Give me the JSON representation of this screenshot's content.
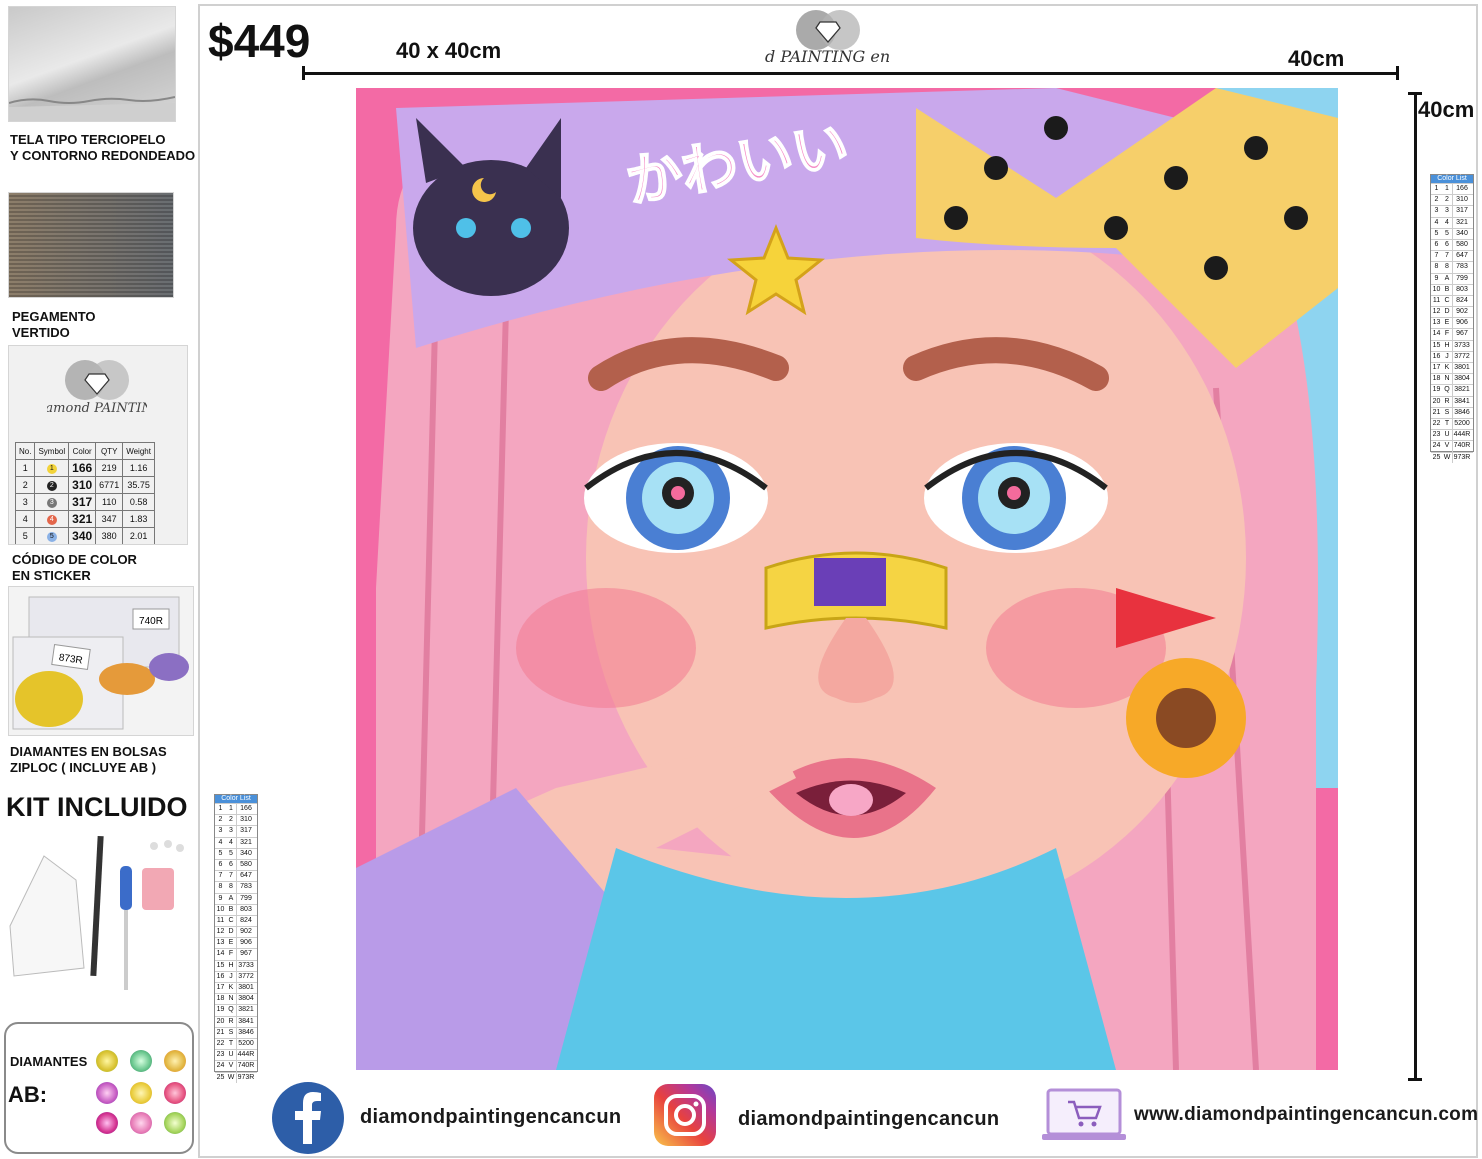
{
  "sidebar": {
    "velvet_caption": [
      "TELA TIPO TERCIOPELO",
      "Y CONTORNO REDONDEADO"
    ],
    "glue_caption": [
      "PEGAMENTO",
      "VERTIDO"
    ],
    "sticker_caption": [
      "CÓDIGO DE COLOR",
      "EN STICKER"
    ],
    "bags_caption": [
      "DIAMANTES EN BOLSAS",
      "ZIPLOC ( INCLUYE AB )"
    ],
    "kit_title": "KIT INCLUIDO",
    "diamonds_label": "DIAMANTES",
    "ab_label": "AB:",
    "sticker_table": {
      "headers": [
        "No.",
        "Symbol",
        "Color",
        "QTY",
        "Weight"
      ],
      "rows": [
        [
          "1",
          "1",
          "166",
          "219",
          "1.16"
        ],
        [
          "2",
          "2",
          "310",
          "6771",
          "35.75"
        ],
        [
          "3",
          "3",
          "317",
          "110",
          "0.58"
        ],
        [
          "4",
          "4",
          "321",
          "347",
          "1.83"
        ],
        [
          "5",
          "5",
          "340",
          "380",
          "2.01"
        ]
      ]
    },
    "bag_labels": [
      "740R",
      "873R"
    ]
  },
  "main": {
    "price": "$449",
    "size_label": "40 x 40cm",
    "width_label": "40cm",
    "height_label": "40cm",
    "brand_logo_text": "Diamond PAINTING en cancún",
    "art_text": "かわいい"
  },
  "legend": {
    "title": "Color List",
    "colors": [
      "166",
      "310",
      "317",
      "321",
      "340",
      "580",
      "647",
      "783",
      "799",
      "803",
      "824",
      "902",
      "906",
      "967",
      "3733",
      "3772",
      "3801",
      "3804",
      "3821",
      "3841",
      "3846",
      "5200",
      "444R",
      "740R",
      "973R"
    ],
    "symbols": [
      "1",
      "2",
      "3",
      "4",
      "5",
      "6",
      "7",
      "8",
      "A",
      "B",
      "C",
      "D",
      "E",
      "F",
      "H",
      "J",
      "K",
      "N",
      "Q",
      "R",
      "S",
      "T",
      "U",
      "V",
      "W",
      "X"
    ]
  },
  "footer": {
    "facebook": "diamondpaintingencancun",
    "instagram": "diamondpaintingencancun",
    "website": "www.diamondpaintingencancun.com"
  },
  "colors": {
    "facebook_blue": "#2d5ea8",
    "hat_purple": "#c9a8ec",
    "hair_pink": "#f4a6c0",
    "bow_yellow": "#f6cf6a"
  }
}
